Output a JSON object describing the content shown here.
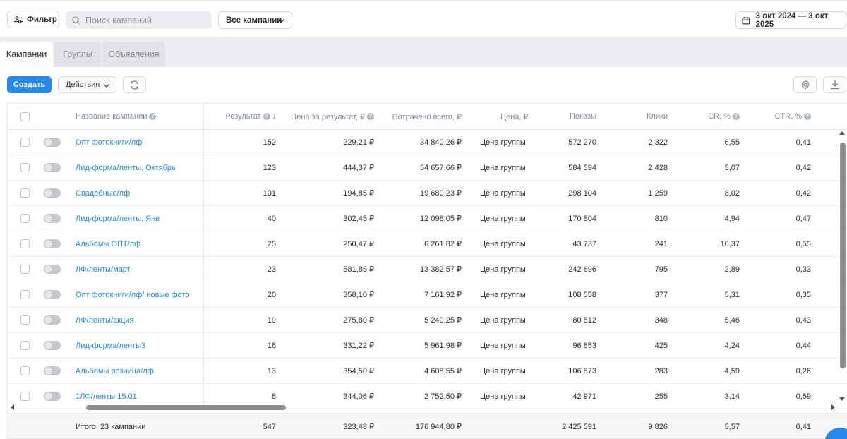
{
  "toolbar": {
    "filter_label": "Фильтр",
    "search_placeholder": "Поиск кампаний",
    "campaign_select": "Все кампании",
    "date_range": "3 окт 2024 — 3 окт 2025"
  },
  "tabs": [
    {
      "label": "Кампании",
      "active": true
    },
    {
      "label": "Группы",
      "active": false
    },
    {
      "label": "Объявления",
      "active": false
    }
  ],
  "actions": {
    "create_label": "Создать",
    "actions_label": "Действия"
  },
  "table": {
    "headers": {
      "name": "Название кампании",
      "result": "Результат",
      "cost_per_result": "Цена за результат, ₽",
      "spent": "Потрачено всего, ₽",
      "price": "Цена, ₽",
      "impressions": "Показы",
      "clicks": "Клики",
      "cr": "CR, %",
      "ctr": "CTR, %"
    },
    "rows": [
      {
        "name": "Опт фотокниги/лф",
        "result": "152",
        "cpr": "229,21 ₽",
        "spent": "34 840,26 ₽",
        "price": "Цена группы",
        "impressions": "572 270",
        "clicks": "2 322",
        "cr": "6,55",
        "ctr": "0,41"
      },
      {
        "name": "Лид-форма/ленты. Октябрь",
        "result": "123",
        "cpr": "444,37 ₽",
        "spent": "54 657,66 ₽",
        "price": "Цена группы",
        "impressions": "584 594",
        "clicks": "2 428",
        "cr": "5,07",
        "ctr": "0,42"
      },
      {
        "name": "Свадебные/лф",
        "result": "101",
        "cpr": "194,85 ₽",
        "spent": "19 680,23 ₽",
        "price": "Цена группы",
        "impressions": "298 104",
        "clicks": "1 259",
        "cr": "8,02",
        "ctr": "0,42"
      },
      {
        "name": "Лид-форма/ленты. Янв",
        "result": "40",
        "cpr": "302,45 ₽",
        "spent": "12 098,05 ₽",
        "price": "Цена группы",
        "impressions": "170 804",
        "clicks": "810",
        "cr": "4,94",
        "ctr": "0,47"
      },
      {
        "name": "Альбомы ОПТ/лф",
        "result": "25",
        "cpr": "250,47 ₽",
        "spent": "6 261,82 ₽",
        "price": "Цена группы",
        "impressions": "43 737",
        "clicks": "241",
        "cr": "10,37",
        "ctr": "0,55"
      },
      {
        "name": "ЛФ/ленты/март",
        "result": "23",
        "cpr": "581,85 ₽",
        "spent": "13 382,57 ₽",
        "price": "Цена группы",
        "impressions": "242 696",
        "clicks": "795",
        "cr": "2,89",
        "ctr": "0,33"
      },
      {
        "name": "Опт фотокниги/лф/ новые фото",
        "result": "20",
        "cpr": "358,10 ₽",
        "spent": "7 161,92 ₽",
        "price": "Цена группы",
        "impressions": "108 558",
        "clicks": "377",
        "cr": "5,31",
        "ctr": "0,35"
      },
      {
        "name": "ЛФ/ленты/акция",
        "result": "19",
        "cpr": "275,80 ₽",
        "spent": "5 240,25 ₽",
        "price": "Цена группы",
        "impressions": "80 812",
        "clicks": "348",
        "cr": "5,46",
        "ctr": "0,43"
      },
      {
        "name": "Лид-форма/ленты3",
        "result": "18",
        "cpr": "331,22 ₽",
        "spent": "5 961,98 ₽",
        "price": "Цена группы",
        "impressions": "96 853",
        "clicks": "425",
        "cr": "4,24",
        "ctr": "0,44"
      },
      {
        "name": "Альбомы розница/лф",
        "result": "13",
        "cpr": "354,50 ₽",
        "spent": "4 608,55 ₽",
        "price": "Цена группы",
        "impressions": "106 873",
        "clicks": "283",
        "cr": "4,59",
        "ctr": "0,26"
      },
      {
        "name": "1ЛФ/ленты 15.01",
        "result": "8",
        "cpr": "344,06 ₽",
        "spent": "2 752,50 ₽",
        "price": "Цена группы",
        "impressions": "42 971",
        "clicks": "255",
        "cr": "3,14",
        "ctr": "0,59"
      }
    ],
    "total": {
      "label": "Итого: 23 кампании",
      "result": "547",
      "cpr": "323,48 ₽",
      "spent": "176 944,80 ₽",
      "impressions": "2 425 591",
      "clicks": "9 826",
      "cr": "5,57",
      "ctr": "0,41"
    }
  },
  "colors": {
    "accent": "#2688eb",
    "link": "#2688eb",
    "muted_text": "#818c99"
  }
}
